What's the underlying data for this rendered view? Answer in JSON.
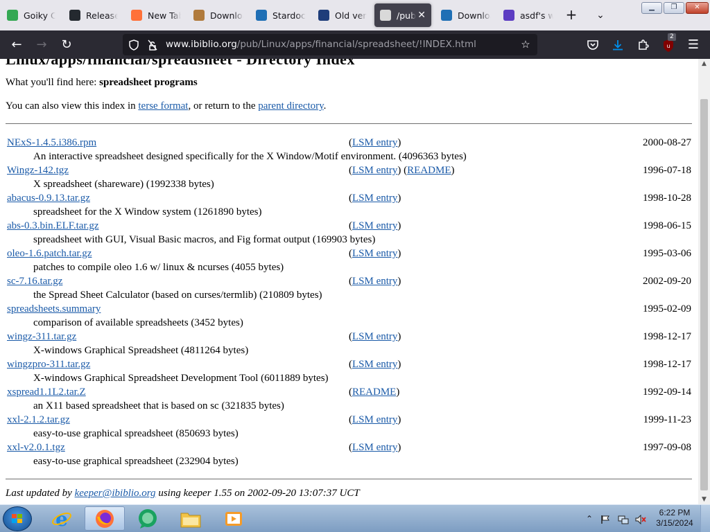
{
  "browser": {
    "tabs": [
      {
        "label": "Goiky Ca",
        "icon": "maps-pin-icon",
        "color": "#34a853"
      },
      {
        "label": "Release",
        "icon": "github-icon",
        "color": "#24292f"
      },
      {
        "label": "New Tab",
        "icon": "firefox-icon",
        "color": "#ff7139"
      },
      {
        "label": "Downloa",
        "icon": "sandwich-icon",
        "color": "#b07a3c"
      },
      {
        "label": "Stardock",
        "icon": "stardock-icon",
        "color": "#1f6fb5"
      },
      {
        "label": "Old versi",
        "icon": "oldversion-icon",
        "color": "#1e3d7a"
      },
      {
        "label": "/pub",
        "icon": "ibiblio-icon",
        "color": "#d9d9d9",
        "active": true
      },
      {
        "label": "Downloa",
        "icon": "stardock-icon",
        "color": "#1f6fb5"
      },
      {
        "label": "asdf's wo",
        "icon": "asdf-icon",
        "color": "#5c3cc2"
      }
    ],
    "new_tab_glyph": "+",
    "list_tabs_glyph": "⌄",
    "url": {
      "domain": "www.ibiblio.org",
      "path": "/pub/Linux/apps/financial/spreadsheet/!INDEX.html"
    },
    "extension_badge": "2",
    "accent_color": "#0090ed"
  },
  "page": {
    "clipped_heading": "Linux/apps/financial/spreadsheet - Directory Index",
    "intro_prefix": "What you'll find here: ",
    "intro_topic": "spreadsheet programs",
    "also_prefix": "You can also view this index in ",
    "terse_link": "terse format",
    "also_middle": ", or return to the ",
    "parent_link": "parent directory",
    "also_suffix": ".",
    "entries": [
      {
        "file": "NExS-1.4.5.i386.rpm",
        "links": [
          "LSM entry"
        ],
        "date": "2000-08-27",
        "desc": "An interactive spreadsheet designed specifically for the X Window/Motif environment. (4096363 bytes)"
      },
      {
        "file": "Wingz-142.tgz",
        "links": [
          "LSM entry",
          "README"
        ],
        "date": "1996-07-18",
        "desc": "X spreadsheet (shareware) (1992338 bytes)"
      },
      {
        "file": "abacus-0.9.13.tar.gz",
        "links": [
          "LSM entry"
        ],
        "date": "1998-10-28",
        "desc": "spreadsheet for the X Window system (1261890 bytes)"
      },
      {
        "file": "abs-0.3.bin.ELF.tar.gz",
        "links": [
          "LSM entry"
        ],
        "date": "1998-06-15",
        "desc": "spreadsheet with GUI, Visual Basic macros, and Fig format output (169903 bytes)"
      },
      {
        "file": "oleo-1.6.patch.tar.gz",
        "links": [
          "LSM entry"
        ],
        "date": "1995-03-06",
        "desc": "patches to compile oleo 1.6 w/ linux & ncurses (4055 bytes)"
      },
      {
        "file": "sc-7.16.tar.gz",
        "links": [
          "LSM entry"
        ],
        "date": "2002-09-20",
        "desc": "the Spread Sheet Calculator (based on curses/termlib) (210809 bytes)"
      },
      {
        "file": "spreadsheets.summary",
        "links": [],
        "date": "1995-02-09",
        "desc": "comparison of available spreadsheets (3452 bytes)"
      },
      {
        "file": "wingz-311.tar.gz",
        "links": [
          "LSM entry"
        ],
        "date": "1998-12-17",
        "desc": "X-windows Graphical Spreadsheet (4811264 bytes)"
      },
      {
        "file": "wingzpro-311.tar.gz",
        "links": [
          "LSM entry"
        ],
        "date": "1998-12-17",
        "desc": "X-windows Graphical Spreadsheet Development Tool (6011889 bytes)"
      },
      {
        "file": "xspread1.1L2.tar.Z",
        "links": [
          "README"
        ],
        "date": "1992-09-14",
        "desc": "an X11 based spreadsheet that is based on sc (321835 bytes)"
      },
      {
        "file": "xxl-2.1.2.tar.gz",
        "links": [
          "LSM entry"
        ],
        "date": "1999-11-23",
        "desc": "easy-to-use graphical spreadsheet (850693 bytes)"
      },
      {
        "file": "xxl-v2.0.1.tgz",
        "links": [
          "LSM entry"
        ],
        "date": "1997-09-08",
        "desc": "easy-to-use graphical spreadsheet (232904 bytes)"
      }
    ],
    "footer_prefix": "Last updated by ",
    "footer_link": "keeper@ibiblio.org",
    "footer_suffix": " using keeper 1.55 on 2002-09-20 13:07:37 UCT"
  },
  "taskbar": {
    "apps": [
      "internet-explorer-icon",
      "firefox-icon",
      "chat-icon",
      "file-explorer-icon",
      "media-player-icon"
    ],
    "clock_time": "6:22 PM",
    "clock_date": "3/15/2024"
  }
}
